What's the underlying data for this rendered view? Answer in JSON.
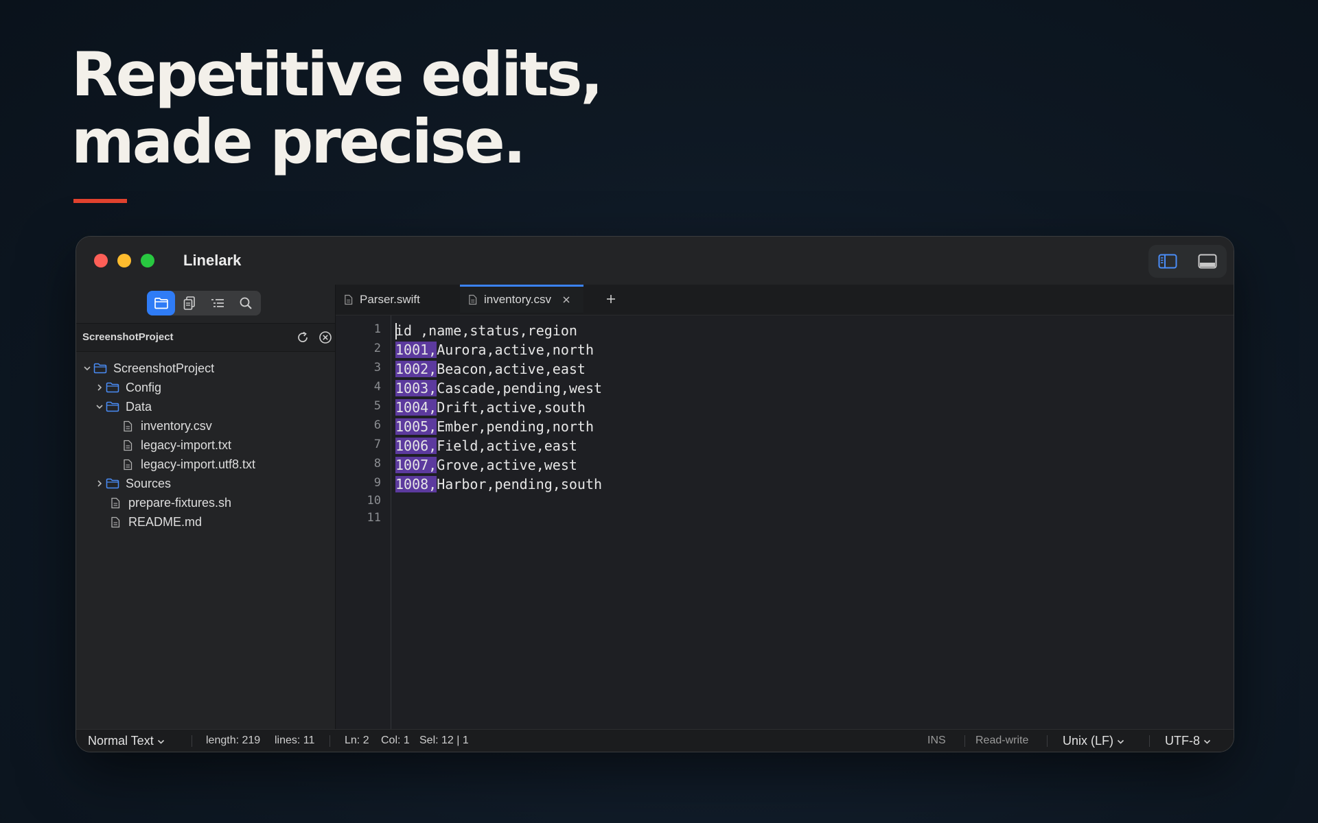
{
  "hero": {
    "line1": "Repetitive edits,",
    "line2": "made precise."
  },
  "colors": {
    "accent": "#e2432f",
    "selection": "#5c3a9e",
    "active_blue": "#2f7cf6"
  },
  "window": {
    "app_title": "Linelark",
    "title_tools": [
      "sidebar-toggle-icon",
      "panel-toggle-icon"
    ]
  },
  "sidebar": {
    "tabs": [
      "folder-icon",
      "documents-icon",
      "outline-icon",
      "search-icon"
    ],
    "active_tab": 0,
    "header_title": "ScreenshotProject",
    "tree": [
      {
        "label": "ScreenshotProject",
        "type": "folder",
        "expanded": true
      },
      {
        "label": "Config",
        "type": "folder",
        "expanded": false
      },
      {
        "label": "Data",
        "type": "folder",
        "expanded": true
      },
      {
        "label": "inventory.csv",
        "type": "file"
      },
      {
        "label": "legacy-import.txt",
        "type": "file"
      },
      {
        "label": "legacy-import.utf8.txt",
        "type": "file"
      },
      {
        "label": "Sources",
        "type": "folder",
        "expanded": false
      },
      {
        "label": "prepare-fixtures.sh",
        "type": "file"
      },
      {
        "label": "README.md",
        "type": "file"
      }
    ]
  },
  "tabs": [
    {
      "label": "Parser.swift",
      "active": false
    },
    {
      "label": "inventory.csv",
      "active": true
    }
  ],
  "editor": {
    "line_numbers": [
      "1",
      "2",
      "3",
      "4",
      "5",
      "6",
      "7",
      "8",
      "9",
      "10",
      "11"
    ],
    "lines": [
      {
        "sel": "",
        "rest": "id ,name,status,region"
      },
      {
        "sel": "1001,",
        "rest": "Aurora,active,north"
      },
      {
        "sel": "1002,",
        "rest": "Beacon,active,east"
      },
      {
        "sel": "1003,",
        "rest": "Cascade,pending,west"
      },
      {
        "sel": "1004,",
        "rest": "Drift,active,south"
      },
      {
        "sel": "1005,",
        "rest": "Ember,pending,north"
      },
      {
        "sel": "1006,",
        "rest": "Field,active,east"
      },
      {
        "sel": "1007,",
        "rest": "Grove,active,west"
      },
      {
        "sel": "1008,",
        "rest": "Harbor,pending,south"
      },
      {
        "sel": "",
        "rest": ""
      },
      {
        "sel": "",
        "rest": ""
      }
    ]
  },
  "status": {
    "syntax": "Normal Text",
    "length": "length: 219",
    "lines": "lines: 11",
    "ln": "Ln: 2",
    "col": "Col: 1",
    "sel": "Sel: 12 | 1",
    "mode": "INS",
    "access": "Read-write",
    "line_ending": "Unix (LF)",
    "encoding": "UTF-8"
  }
}
